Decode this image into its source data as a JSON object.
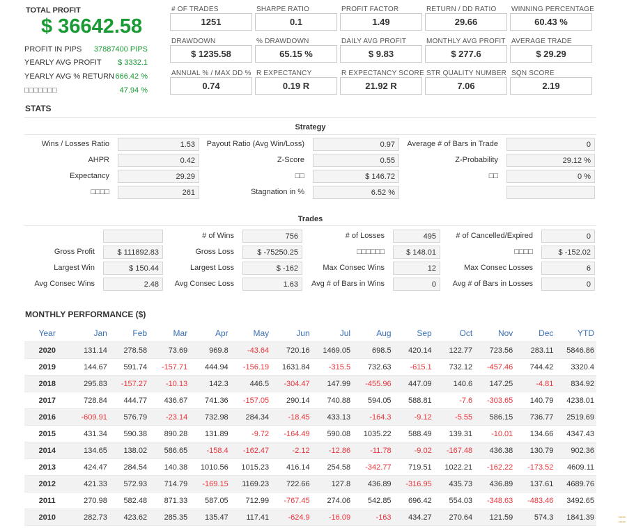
{
  "summary": {
    "total_profit_label": "TOTAL PROFIT",
    "total_profit_value": "$ 36642.58",
    "rows": [
      {
        "label": "PROFIT IN PIPS",
        "value": "37887400 PIPS"
      },
      {
        "label": "YEARLY AVG PROFIT",
        "value": "$ 3332.1"
      },
      {
        "label": "YEARLY AVG % RETURN",
        "value": "666.42 %"
      },
      {
        "label": "□□□□□□□",
        "value": "47.94 %"
      }
    ]
  },
  "metrics": [
    {
      "label": "# OF TRADES",
      "value": "1251"
    },
    {
      "label": "SHARPE RATIO",
      "value": "0.1"
    },
    {
      "label": "PROFIT FACTOR",
      "value": "1.49"
    },
    {
      "label": "RETURN / DD RATIO",
      "value": "29.66"
    },
    {
      "label": "WINNING PERCENTAGE",
      "value": "60.43 %"
    },
    {
      "label": "DRAWDOWN",
      "value": "$ 1235.58"
    },
    {
      "label": "% DRAWDOWN",
      "value": "65.15 %"
    },
    {
      "label": "DAILY AVG PROFIT",
      "value": "$ 9.83"
    },
    {
      "label": "MONTHLY AVG PROFIT",
      "value": "$ 277.6"
    },
    {
      "label": "AVERAGE TRADE",
      "value": "$ 29.29"
    },
    {
      "label": "ANNUAL % / MAX DD %",
      "value": "0.74"
    },
    {
      "label": "R EXPECTANCY",
      "value": "0.19 R"
    },
    {
      "label": "R EXPECTANCY SCORE",
      "value": "21.92 R"
    },
    {
      "label": "STR QUALITY NUMBER",
      "value": "7.06"
    },
    {
      "label": "SQN SCORE",
      "value": "2.19"
    }
  ],
  "stats": {
    "title": "STATS",
    "strategy_title": "Strategy",
    "strategy": [
      [
        {
          "label": "Wins / Losses Ratio",
          "value": "1.53"
        },
        {
          "label": "Payout Ratio (Avg Win/Loss)",
          "value": "0.97"
        },
        {
          "label": "Average # of Bars in Trade",
          "value": "0"
        }
      ],
      [
        {
          "label": "AHPR",
          "value": "0.42"
        },
        {
          "label": "Z-Score",
          "value": "0.55"
        },
        {
          "label": "Z-Probability",
          "value": "29.12 %"
        }
      ],
      [
        {
          "label": "Expectancy",
          "value": "29.29"
        },
        {
          "label": "□□",
          "value": "$ 146.72"
        },
        {
          "label": "□□",
          "value": "0 %"
        }
      ],
      [
        {
          "label": "□□□□",
          "value": "261"
        },
        {
          "label": "Stagnation in %",
          "value": "6.52 %"
        },
        {
          "label": "",
          "value": ""
        }
      ]
    ],
    "trades_title": "Trades",
    "trades": [
      [
        {
          "label": "",
          "value": ""
        },
        {
          "label": "# of Wins",
          "value": "756"
        },
        {
          "label": "# of Losses",
          "value": "495"
        },
        {
          "label": "# of Cancelled/Expired",
          "value": "0"
        }
      ],
      [
        {
          "label": "Gross Profit",
          "value": "$ 111892.83"
        },
        {
          "label": "Gross Loss",
          "value": "$ -75250.25"
        },
        {
          "label": "□□□□□□",
          "value": "$ 148.01"
        },
        {
          "label": "□□□□",
          "value": "$ -152.02"
        }
      ],
      [
        {
          "label": "Largest Win",
          "value": "$ 150.44"
        },
        {
          "label": "Largest Loss",
          "value": "$ -162"
        },
        {
          "label": "Max Consec Wins",
          "value": "12"
        },
        {
          "label": "Max Consec Losses",
          "value": "6"
        }
      ],
      [
        {
          "label": "Avg Consec Wins",
          "value": "2.48"
        },
        {
          "label": "Avg Consec Loss",
          "value": "1.63"
        },
        {
          "label": "Avg # of Bars in Wins",
          "value": "0"
        },
        {
          "label": "Avg # of Bars in Losses",
          "value": "0"
        }
      ]
    ]
  },
  "monthly": {
    "title": "MONTHLY PERFORMANCE ($)",
    "columns": [
      "Year",
      "Jan",
      "Feb",
      "Mar",
      "Apr",
      "May",
      "Jun",
      "Jul",
      "Aug",
      "Sep",
      "Oct",
      "Nov",
      "Dec",
      "YTD"
    ],
    "rows": [
      [
        "2020",
        "131.14",
        "278.58",
        "73.69",
        "969.8",
        "-43.64",
        "720.16",
        "1469.05",
        "698.5",
        "420.14",
        "122.77",
        "723.56",
        "283.11",
        "5846.86"
      ],
      [
        "2019",
        "144.67",
        "591.74",
        "-157.71",
        "444.94",
        "-156.19",
        "1631.84",
        "-315.5",
        "732.63",
        "-615.1",
        "732.12",
        "-457.46",
        "744.42",
        "3320.4"
      ],
      [
        "2018",
        "295.83",
        "-157.27",
        "-10.13",
        "142.3",
        "446.5",
        "-304.47",
        "147.99",
        "-455.96",
        "447.09",
        "140.6",
        "147.25",
        "-4.81",
        "834.92"
      ],
      [
        "2017",
        "728.84",
        "444.77",
        "436.67",
        "741.36",
        "-157.05",
        "290.14",
        "740.88",
        "594.05",
        "588.81",
        "-7.6",
        "-303.65",
        "140.79",
        "4238.01"
      ],
      [
        "2016",
        "-609.91",
        "576.79",
        "-23.14",
        "732.98",
        "284.34",
        "-18.45",
        "433.13",
        "-164.3",
        "-9.12",
        "-5.55",
        "586.15",
        "736.77",
        "2519.69"
      ],
      [
        "2015",
        "431.34",
        "590.38",
        "890.28",
        "131.89",
        "-9.72",
        "-164.49",
        "590.08",
        "1035.22",
        "588.49",
        "139.31",
        "-10.01",
        "134.66",
        "4347.43"
      ],
      [
        "2014",
        "134.65",
        "138.02",
        "586.65",
        "-158.4",
        "-162.47",
        "-2.12",
        "-12.86",
        "-11.78",
        "-9.02",
        "-167.48",
        "436.38",
        "130.79",
        "902.36"
      ],
      [
        "2013",
        "424.47",
        "284.54",
        "140.38",
        "1010.56",
        "1015.23",
        "416.14",
        "254.58",
        "-342.77",
        "719.51",
        "1022.21",
        "-162.22",
        "-173.52",
        "4609.11"
      ],
      [
        "2012",
        "421.33",
        "572.93",
        "714.79",
        "-169.15",
        "1169.23",
        "722.66",
        "127.8",
        "436.89",
        "-316.95",
        "435.73",
        "436.89",
        "137.61",
        "4689.76"
      ],
      [
        "2011",
        "270.98",
        "582.48",
        "871.33",
        "587.05",
        "712.99",
        "-767.45",
        "274.06",
        "542.85",
        "696.42",
        "554.03",
        "-348.63",
        "-483.46",
        "3492.65"
      ],
      [
        "2010",
        "282.73",
        "423.62",
        "285.35",
        "135.47",
        "117.41",
        "-624.9",
        "-16.09",
        "-163",
        "434.27",
        "270.64",
        "121.59",
        "574.3",
        "1841.39"
      ]
    ]
  },
  "colors": {
    "profit_green": "#1a9a35",
    "negative_red": "#e8343a",
    "header_blue": "#3a6fb5"
  }
}
